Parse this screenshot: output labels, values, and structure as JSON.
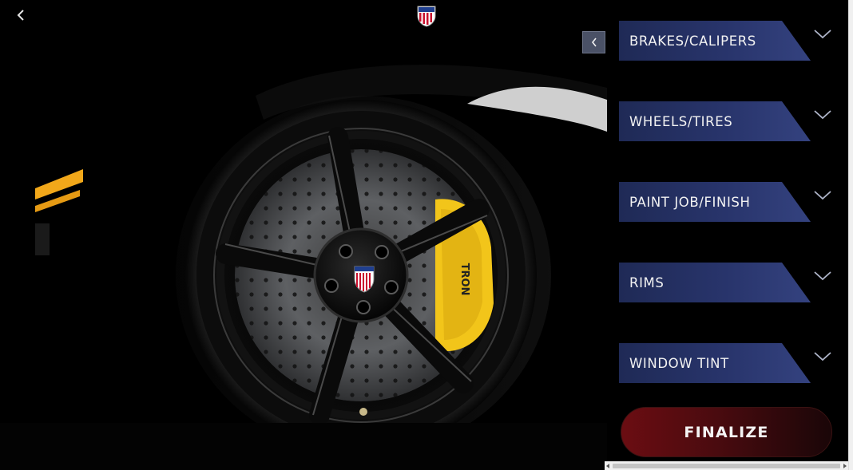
{
  "header": {
    "back_icon": "chevron-left-icon",
    "logo_icon": "shield-flag-logo"
  },
  "panel": {
    "collapse_icon": "chevron-left-icon",
    "options": [
      {
        "label": "BRAKES/CALIPERS",
        "expand_icon": "chevron-down-icon"
      },
      {
        "label": "WHEELS/TIRES",
        "expand_icon": "chevron-down-icon"
      },
      {
        "label": "PAINT JOB/FINISH",
        "expand_icon": "chevron-down-icon"
      },
      {
        "label": "RIMS",
        "expand_icon": "chevron-down-icon"
      },
      {
        "label": "WINDOW TINT",
        "expand_icon": "chevron-down-icon"
      }
    ],
    "finalize_label": "FINALIZE"
  },
  "scene": {
    "caliper_text": "TRON"
  },
  "colors": {
    "option_bg": "#28346b",
    "finalize_bg": "#6b0d12",
    "caliper": "#f2c51a",
    "collapse_bg": "#4a5166"
  }
}
